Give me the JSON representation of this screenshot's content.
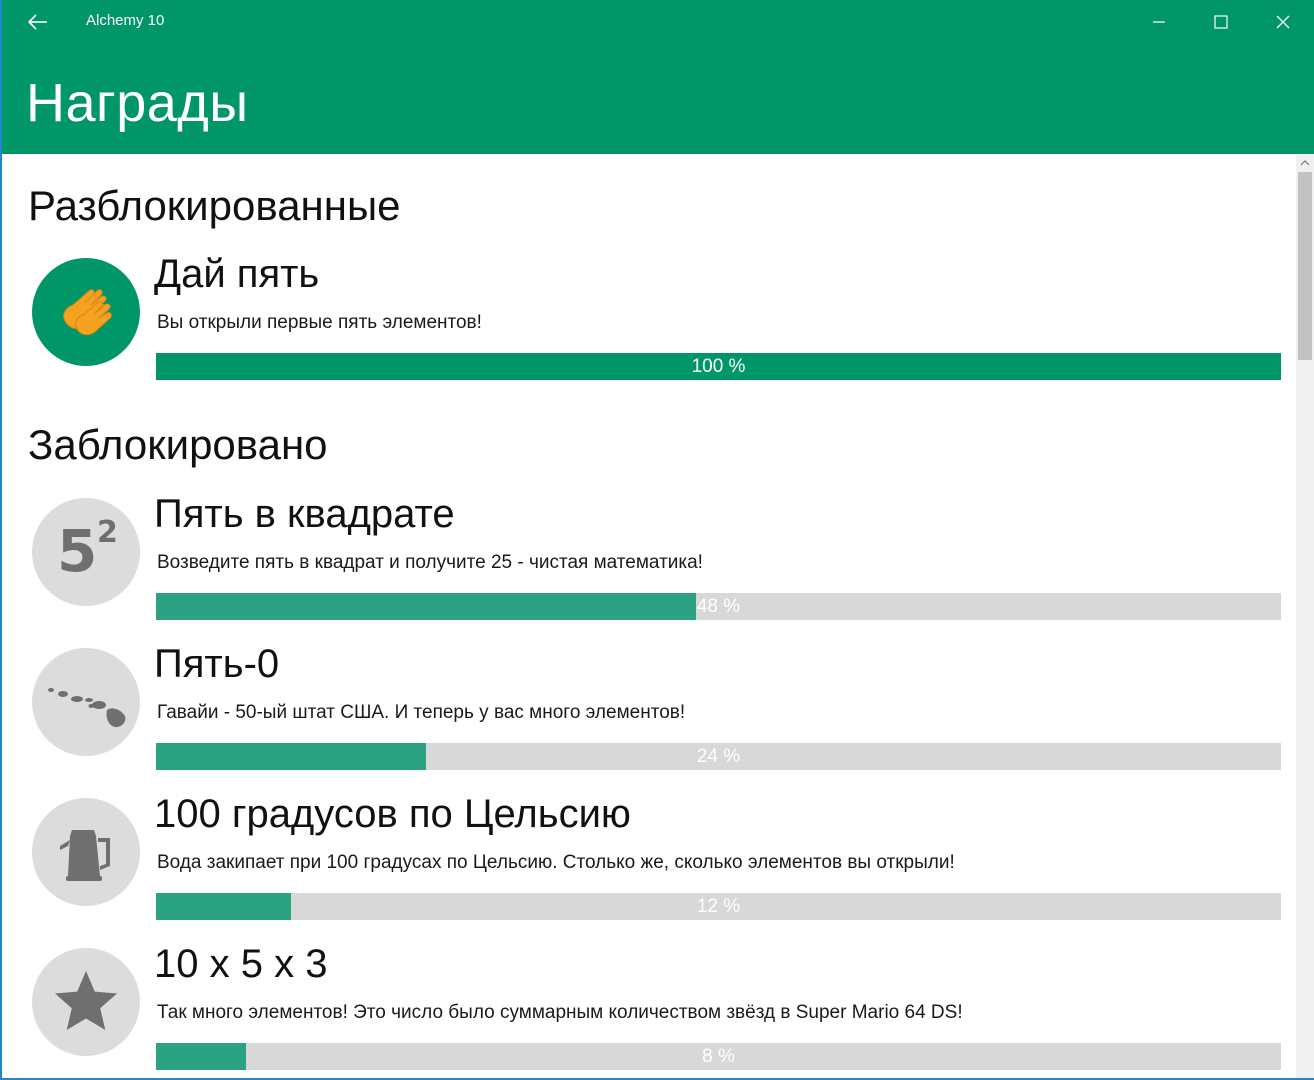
{
  "window": {
    "app_title": "Alchemy 10",
    "accent": "#009668",
    "back_icon": "arrow-left-icon",
    "minimize_icon": "minimize-icon",
    "maximize_icon": "maximize-icon",
    "close_icon": "close-icon"
  },
  "header": {
    "title": "Награды"
  },
  "sections": {
    "unlocked": {
      "title": "Разблокированные"
    },
    "locked": {
      "title": "Заблокировано"
    }
  },
  "awards": [
    {
      "name": "Дай пять",
      "description": "Вы открыли первые пять элементов!",
      "progress": 1.0,
      "progress_label": "100 %",
      "icon": "high-five-icon",
      "unlocked": true
    },
    {
      "name": "Пять в квадрате",
      "description": "Возведите пять в квадрат и получите 25 - чистая математика!",
      "progress": 0.48,
      "progress_label": "48 %",
      "icon": "five-squared-icon",
      "icon_text": "5",
      "icon_sup": "2",
      "unlocked": false
    },
    {
      "name": "Пять-0",
      "description": "Гавайи - 50-ый штат США. И теперь у вас много элементов!",
      "progress": 0.24,
      "progress_label": "24 %",
      "icon": "hawaii-islands-icon",
      "unlocked": false
    },
    {
      "name": "100 градусов по Цельсию",
      "description": "Вода закипает при 100 градусах по Цельсию. Столько же, сколько элементов вы открыли!",
      "progress": 0.12,
      "progress_label": "12 %",
      "icon": "kettle-icon",
      "unlocked": false
    },
    {
      "name": "10 x 5 x 3",
      "description": "Так много элементов! Это число было суммарным количеством звёзд в Super Mario 64 DS!",
      "progress": 0.08,
      "progress_label": "8 %",
      "icon": "star-icon",
      "unlocked": false
    }
  ],
  "colors": {
    "unlocked_fill": "#009668",
    "locked_fill": "#2ba282",
    "bar_track": "#d8d8d8",
    "locked_circle": "#dcdcdc",
    "locked_icon": "#6f6f6f",
    "hand": "#f5a21e"
  }
}
